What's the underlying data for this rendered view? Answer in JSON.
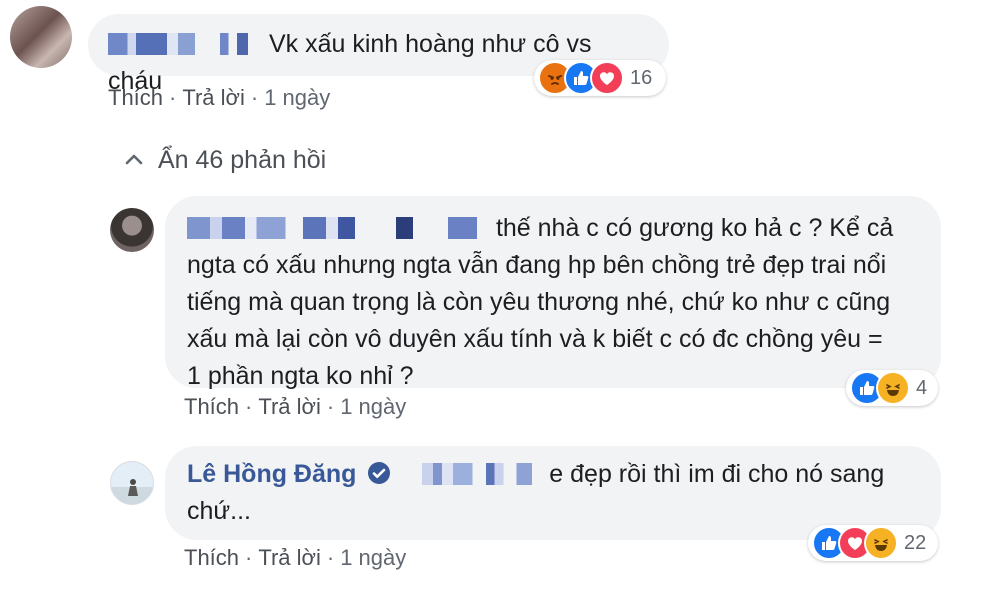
{
  "comments": [
    {
      "text": "Vk xấu kinh hoàng như cô vs cháu",
      "reactions": [
        "angry-icon",
        "like-icon",
        "love-icon"
      ],
      "reaction_count": "16",
      "actions": {
        "like": "Thích",
        "reply": "Trả lời",
        "time": "1 ngày"
      }
    },
    {
      "text_lines": [
        "thế nhà c có gương ko hả c ? Kể cả",
        "ngta có xấu nhưng ngta vẫn đang hp bên chồng trẻ đẹp trai nổi",
        "tiếng mà quan trọng là còn yêu thương nhé, chứ ko như c cũng",
        "xấu mà lại còn vô duyên xấu tính và k biết c có đc chồng yêu =",
        "1 phần ngta ko nhỉ ?"
      ],
      "reactions": [
        "like-icon",
        "haha-icon"
      ],
      "reaction_count": "4",
      "actions": {
        "like": "Thích",
        "reply": "Trả lời",
        "time": "1 ngày"
      }
    },
    {
      "author": "Lê Hồng Đăng",
      "verified": true,
      "text_lines": [
        "e đẹp rồi thì im đi cho nó sang",
        "chứ..."
      ],
      "reactions": [
        "like-icon",
        "love-icon",
        "haha-icon"
      ],
      "reaction_count": "22",
      "actions": {
        "like": "Thích",
        "reply": "Trả lời",
        "time": "1 ngày"
      }
    }
  ],
  "replies_toggle": {
    "label": "Ẩn 46 phản hồi"
  },
  "colors": {
    "link": "#385898",
    "bubble": "#f2f3f5",
    "meta": "#606770",
    "like": "#1877f2",
    "love": "#f33e58",
    "haha": "#f7b125"
  }
}
